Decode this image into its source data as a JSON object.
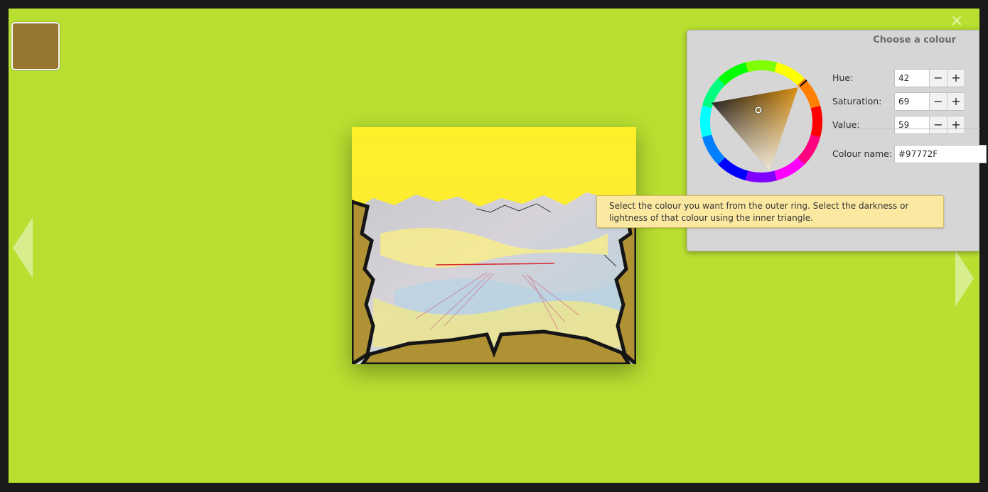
{
  "colors": {
    "background": "#b9df31",
    "selected_swatch": "#97772F",
    "dialog_bg": "#d6d6d6",
    "tooltip_bg": "#fbe9a1"
  },
  "viewer": {
    "close_icon": "×",
    "prev_icon": "triangle-left",
    "next_icon": "triangle-right"
  },
  "dialog": {
    "title": "Choose a colour",
    "hue_label": "Hue:",
    "hue_value": "42",
    "saturation_label": "Saturation:",
    "saturation_value": "69",
    "value_label": "Value:",
    "value_value": "59",
    "colour_name_label": "Colour name:",
    "colour_name_value": "#97772F",
    "minus_symbol": "−",
    "plus_symbol": "+"
  },
  "tooltip": {
    "text": "Select the colour you want from the outer ring. Select the darkness or lightness of that colour using the inner triangle."
  }
}
